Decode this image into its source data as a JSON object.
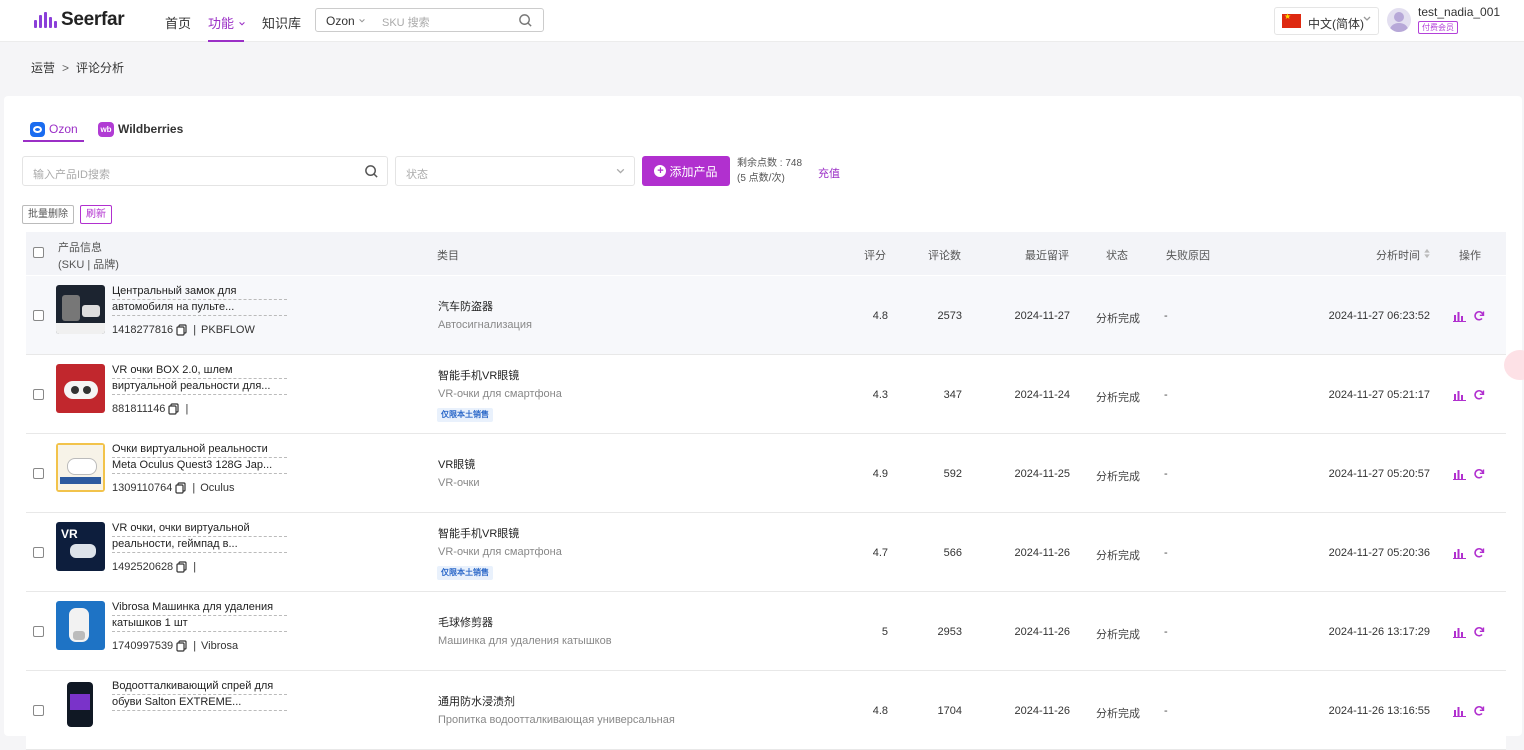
{
  "brand": {
    "name": "Seerfar"
  },
  "nav": {
    "items": [
      {
        "label": "首页"
      },
      {
        "label": "功能"
      },
      {
        "label": "知识库"
      }
    ],
    "search_platform": "Ozon",
    "search_placeholder": "SKU 搜索"
  },
  "header": {
    "language": "中文(简体)",
    "username": "test_nadia_001",
    "member_badge": "付费会员"
  },
  "breadcrumb": {
    "parent": "运营",
    "separator": ">",
    "current": "评论分析"
  },
  "tabs": [
    {
      "label": "Ozon",
      "icon": "ozon-logo-icon"
    },
    {
      "label": "Wildberries",
      "icon": "wb-logo-icon",
      "icon_text": "wb"
    }
  ],
  "filters": {
    "search_placeholder": "输入产品ID搜索",
    "status_placeholder": "状态",
    "add_button": "添加产品",
    "points_line1": "剩余点数 : 748",
    "points_line2": "(5 点数/次)",
    "recharge": "充值",
    "bulk_delete": "批量删除",
    "refresh": "刷新"
  },
  "table": {
    "headers": {
      "product_info": "产品信息",
      "product_info_sub": "(SKU | 品牌)",
      "category": "类目",
      "rating": "评分",
      "reviews": "评论数",
      "last_review": "最近留评",
      "status": "状态",
      "fail_reason": "失败原因",
      "analysis_time": "分析时间",
      "action": "操作"
    },
    "rows": [
      {
        "name1": "Центральный замок для",
        "name2": "автомобиля на пульте...",
        "sku": "1418277816",
        "brand": "PKBFLOW",
        "cat_cn": "汽车防盗器",
        "cat_ru": "Автосигнализация",
        "tag": "",
        "rating": "4.8",
        "reviews": "2573",
        "last_review": "2024-11-27",
        "status": "分析完成",
        "fail": "-",
        "time": "2024-11-27 06:23:52"
      },
      {
        "name1": "VR очки BOX 2.0, шлем",
        "name2": "виртуальной реальности для...",
        "sku": "881811146",
        "brand": "",
        "cat_cn": "智能手机VR眼镜",
        "cat_ru": "VR-очки для смартфона",
        "tag": "仅限本土销售",
        "rating": "4.3",
        "reviews": "347",
        "last_review": "2024-11-24",
        "status": "分析完成",
        "fail": "-",
        "time": "2024-11-27 05:21:17"
      },
      {
        "name1": "Очки виртуальной реальности",
        "name2": "Meta Oculus Quest3 128G Jap...",
        "sku": "1309110764",
        "brand": "Oculus",
        "cat_cn": "VR眼镜",
        "cat_ru": "VR-очки",
        "tag": "",
        "rating": "4.9",
        "reviews": "592",
        "last_review": "2024-11-25",
        "status": "分析完成",
        "fail": "-",
        "time": "2024-11-27 05:20:57"
      },
      {
        "name1": "VR очки, очки виртуальной",
        "name2": "реальности, геймпад в...",
        "sku": "1492520628",
        "brand": "",
        "cat_cn": "智能手机VR眼镜",
        "cat_ru": "VR-очки для смартфона",
        "tag": "仅限本土销售",
        "rating": "4.7",
        "reviews": "566",
        "last_review": "2024-11-26",
        "status": "分析完成",
        "fail": "-",
        "time": "2024-11-27 05:20:36"
      },
      {
        "name1": "Vibrosa Машинка для удаления",
        "name2": "катышков 1 шт",
        "sku": "1740997539",
        "brand": "Vibrosa",
        "cat_cn": "毛球修剪器",
        "cat_ru": "Машинка для удаления катышков",
        "tag": "",
        "rating": "5",
        "reviews": "2953",
        "last_review": "2024-11-26",
        "status": "分析完成",
        "fail": "-",
        "time": "2024-11-26 13:17:29"
      },
      {
        "name1": "Водоотталкивающий спрей для",
        "name2": "обуви Salton EXTREME...",
        "sku": "",
        "brand": "",
        "cat_cn": "通用防水浸渍剂",
        "cat_ru": "Пропитка водоотталкивающая универсальная",
        "tag": "",
        "rating": "4.8",
        "reviews": "1704",
        "last_review": "2024-11-26",
        "status": "分析完成",
        "fail": "-",
        "time": "2024-11-26 13:16:55"
      }
    ]
  },
  "colors": {
    "accent": "#b130cf",
    "tag_bg": "#e9f1fc",
    "tag_text": "#2a67c8"
  }
}
